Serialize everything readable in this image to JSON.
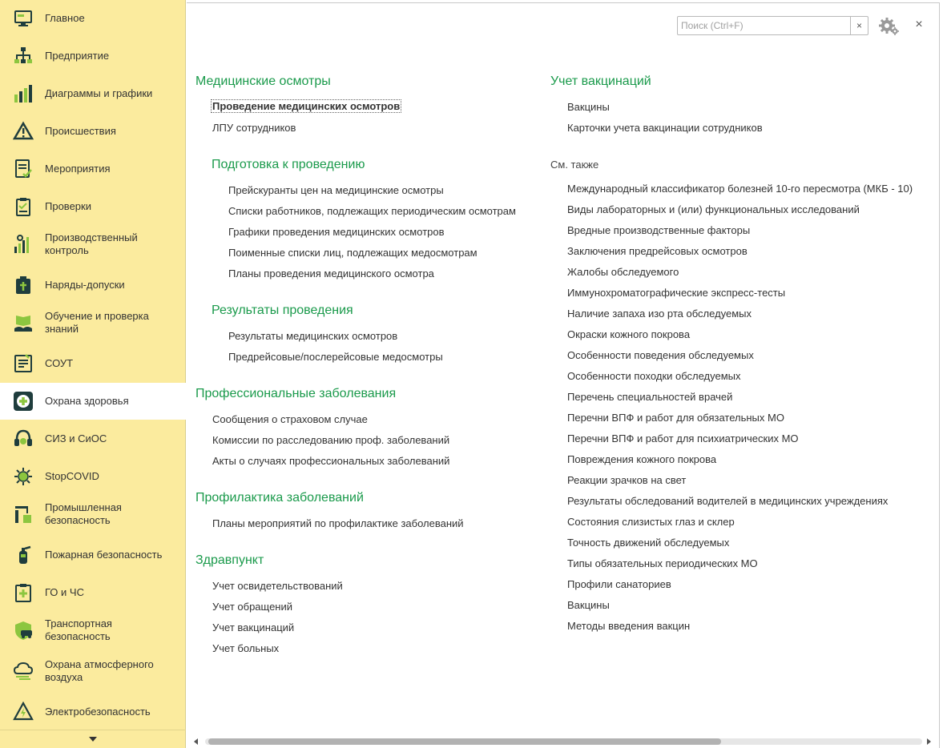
{
  "sidebar": {
    "items": [
      {
        "label": "Главное",
        "icon": "monitor-icon"
      },
      {
        "label": "Предприятие",
        "icon": "org-structure-icon"
      },
      {
        "label": "Диаграммы и графики",
        "icon": "bar-chart-icon"
      },
      {
        "label": "Происшествия",
        "icon": "warning-icon"
      },
      {
        "label": "Мероприятия",
        "icon": "checklist-icon"
      },
      {
        "label": "Проверки",
        "icon": "clipboard-icon"
      },
      {
        "label": "Производственный контроль",
        "icon": "control-chart-icon"
      },
      {
        "label": "Наряды-допуски",
        "icon": "permit-icon"
      },
      {
        "label": "Обучение и проверка знаний",
        "icon": "book-hand-icon"
      },
      {
        "label": "СОУТ",
        "icon": "assessment-icon"
      },
      {
        "label": "Охрана здоровья",
        "icon": "health-cross-icon"
      },
      {
        "label": "СИЗ и СиОС",
        "icon": "protective-gear-icon"
      },
      {
        "label": "StopCOVID",
        "icon": "virus-icon"
      },
      {
        "label": "Промышленная безопасность",
        "icon": "industrial-icon"
      },
      {
        "label": "Пожарная безопасность",
        "icon": "fire-extinguisher-icon"
      },
      {
        "label": "ГО и ЧС",
        "icon": "emergency-icon"
      },
      {
        "label": "Транспортная безопасность",
        "icon": "transport-shield-icon"
      },
      {
        "label": "Охрана атмосферного воздуха",
        "icon": "air-cloud-icon"
      },
      {
        "label": "Электробезопасность",
        "icon": "electric-icon"
      }
    ],
    "active_index": 10
  },
  "header": {
    "search_placeholder": "Поиск (Ctrl+F)",
    "clear_label": "×",
    "close_label": "×"
  },
  "left": {
    "med": {
      "title": "Медицинские осмотры",
      "links": [
        "Проведение медицинских осмотров",
        "ЛПУ сотрудников"
      ]
    },
    "prep": {
      "title": "Подготовка к проведению",
      "links": [
        "Прейскуранты цен на медицинские осмотры",
        "Списки работников, подлежащих периодическим осмотрам",
        "Графики проведения медицинских осмотров",
        "Поименные списки лиц, подлежащих медосмотрам",
        "Планы проведения медицинского осмотра"
      ]
    },
    "results": {
      "title": "Результаты проведения",
      "links": [
        "Результаты медицинских осмотров",
        "Предрейсовые/послерейсовые медосмотры"
      ]
    },
    "prof": {
      "title": "Профессиональные заболевания",
      "links": [
        "Сообщения о страховом случае",
        "Комиссии по расследованию проф. заболеваний",
        "Акты о случаях профессиональных заболеваний"
      ]
    },
    "prev": {
      "title": "Профилактика заболеваний",
      "links": [
        "Планы мероприятий по профилактике заболеваний"
      ]
    },
    "aid": {
      "title": "Здравпункт",
      "links": [
        "Учет освидетельствований",
        "Учет обращений",
        "Учет вакцинаций",
        "Учет больных"
      ]
    }
  },
  "right": {
    "vacc": {
      "title": "Учет вакцинаций",
      "links": [
        "Вакцины",
        "Карточки учета вакцинации сотрудников"
      ]
    },
    "see_also": {
      "title": "См. также",
      "links": [
        "Международный классификатор болезней 10-го пересмотра (МКБ - 10)",
        "Виды лабораторных и (или) функциональных исследований",
        "Вредные производственные факторы",
        "Заключения предрейсовых осмотров",
        "Жалобы обследуемого",
        "Иммунохроматографические экспресс-тесты",
        "Наличие запаха изо рта обследуемых",
        "Окраски кожного покрова",
        "Особенности поведения обследуемых",
        "Особенности походки обследуемых",
        "Перечень специальностей врачей",
        "Перечни ВПФ и работ для обязательных МО",
        "Перечни ВПФ и работ для психиатрических МО",
        "Повреждения кожного покрова",
        "Реакции зрачков на свет",
        "Результаты обследований водителей в медицинских учреждениях",
        "Состояния слизистых глаз и склер",
        "Точность движений обследуемых",
        "Типы обязательных периодических МО",
        "Профили санаториев",
        "Вакцины",
        "Методы введения вакцин"
      ]
    }
  },
  "colors": {
    "sidebar_bg": "#fbeb9e",
    "section_title": "#1a9a4b",
    "icon_dark": "#1f3d3d",
    "icon_green": "#8cc63f"
  }
}
